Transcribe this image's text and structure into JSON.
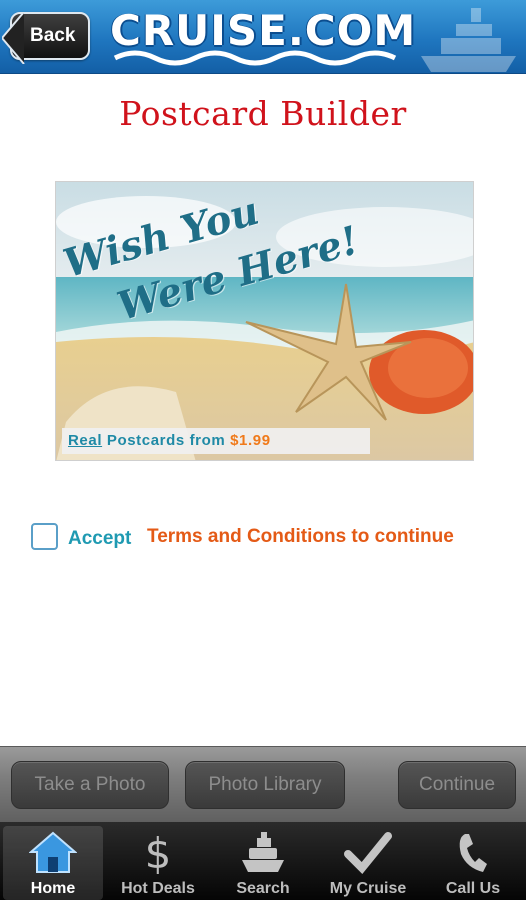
{
  "header": {
    "back_label": "Back",
    "logo_text": "CRUISE.COM",
    "colors": {
      "bar": "#1f76bf",
      "logo": "#ffffff"
    }
  },
  "page": {
    "title": "Postcard Builder",
    "title_color": "#d0121b"
  },
  "postcard": {
    "headline_line1": "Wish You",
    "headline_line2": "Were Here!",
    "promo_real": "Real",
    "promo_text": "Postcards from",
    "promo_price": "$1.99"
  },
  "terms": {
    "checked": false,
    "accept_label": "Accept",
    "link_text": "Terms and Conditions to continue",
    "accept_color": "#1f9ab2",
    "link_color": "#e45a16"
  },
  "actions": {
    "take_photo": "Take a Photo",
    "photo_library": "Photo Library",
    "continue": "Continue"
  },
  "tabs": [
    {
      "label": "Home",
      "icon": "home-icon",
      "active": true
    },
    {
      "label": "Hot Deals",
      "icon": "dollar-icon",
      "active": false
    },
    {
      "label": "Search",
      "icon": "ship-icon",
      "active": false
    },
    {
      "label": "My Cruise",
      "icon": "checkmark-icon",
      "active": false
    },
    {
      "label": "Call Us",
      "icon": "phone-icon",
      "active": false
    }
  ]
}
